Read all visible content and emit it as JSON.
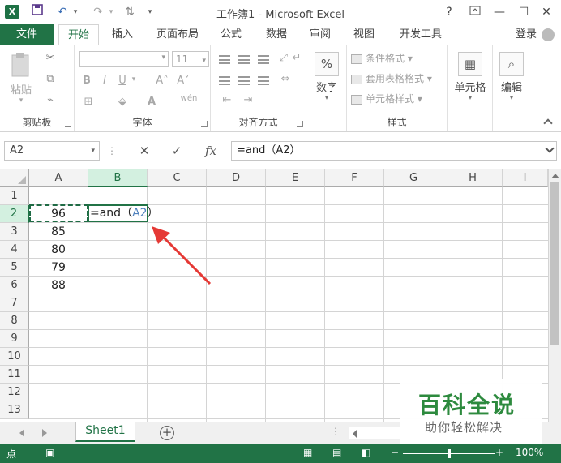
{
  "window": {
    "title": "工作簿1 - Microsoft Excel",
    "app_icon": "excel-logo-icon",
    "quick_access": [
      "save-icon",
      "undo-icon",
      "redo-icon",
      "touch-mode-icon",
      "customize-icon"
    ],
    "controls": {
      "help": "?",
      "ribbon_display": "restore-ribbon-icon",
      "minimize": "—",
      "maximize": "☐",
      "close": "✕"
    }
  },
  "ribbon_tabs": {
    "file": "文件",
    "tabs": [
      "开始",
      "插入",
      "页面布局",
      "公式",
      "数据",
      "审阅",
      "视图",
      "开发工具"
    ],
    "active": "开始",
    "login": "登录"
  },
  "ribbon": {
    "clipboard": {
      "label": "剪贴板",
      "paste": "粘贴"
    },
    "font": {
      "label": "字体",
      "size": "11",
      "bold": "B",
      "italic": "I",
      "underline": "U",
      "grow": "A˄",
      "shrink": "A˅",
      "color": "A",
      "wen": "wén"
    },
    "alignment": {
      "label": "对齐方式"
    },
    "number": {
      "label": "数字",
      "icon_text": "%"
    },
    "styles": {
      "label": "样式",
      "items": [
        "条件格式",
        "套用表格格式",
        "单元格样式"
      ]
    },
    "cells": {
      "label": "单元格"
    },
    "editing": {
      "label": "编辑"
    }
  },
  "formula_bar": {
    "name_box": "A2",
    "cancel": "✕",
    "enter": "✓",
    "fx": "fx",
    "formula": "=and（A2）"
  },
  "grid": {
    "columns": [
      "A",
      "B",
      "C",
      "D",
      "E",
      "F",
      "G",
      "H",
      "I"
    ],
    "rows": [
      "1",
      "2",
      "3",
      "4",
      "5",
      "6",
      "7",
      "8",
      "9",
      "10",
      "11",
      "12",
      "13"
    ],
    "selected_column": "B",
    "selected_row": "2",
    "column_a_values": [
      "96",
      "85",
      "80",
      "79",
      "88"
    ],
    "editing_cell": {
      "prefix": "=and（",
      "ref": "A2",
      "suffix": "）"
    }
  },
  "sheets": {
    "tabs": [
      "Sheet1"
    ],
    "active": "Sheet1",
    "add": "+"
  },
  "status_bar": {
    "mode": "点",
    "zoom": "100%",
    "zoom_fraction": 0.5
  },
  "watermark": {
    "main": "百科全说",
    "sub": "助你轻松解决"
  },
  "colors": {
    "excel_green": "#217346",
    "arrow_red": "#e53935",
    "ref_blue": "#4f81bd"
  }
}
